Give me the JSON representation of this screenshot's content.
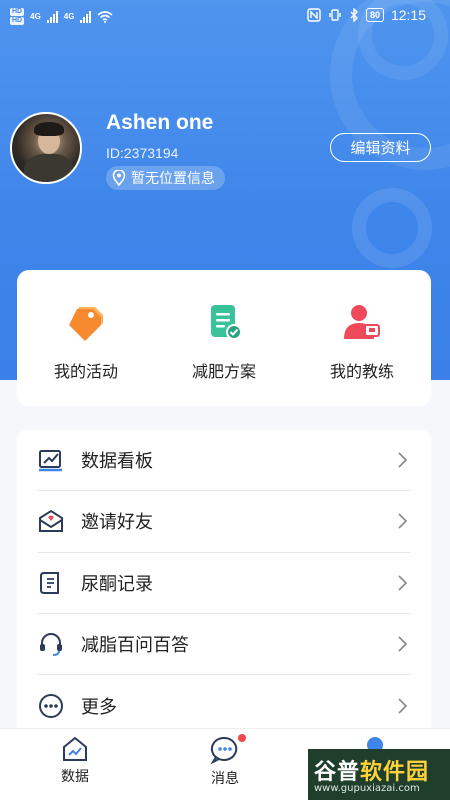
{
  "status_bar": {
    "hd_labels": [
      "HD",
      "HD"
    ],
    "network_labels": [
      "4G",
      "4G"
    ],
    "battery": "80",
    "time": "12:15"
  },
  "profile": {
    "name": "Ashen one",
    "id_text": "ID:2373194",
    "location": "暂无位置信息",
    "edit_button": "编辑资料"
  },
  "quick_actions": [
    {
      "label": "我的活动",
      "icon": "tag-icon",
      "color": "#f78a2e"
    },
    {
      "label": "减肥方案",
      "icon": "plan-document-icon",
      "color": "#3ac29a"
    },
    {
      "label": "我的教练",
      "icon": "coach-icon",
      "color": "#ee4a5b"
    }
  ],
  "menu": [
    {
      "label": "数据看板",
      "icon": "chart-board-icon"
    },
    {
      "label": "邀请好友",
      "icon": "invite-mail-icon"
    },
    {
      "label": "尿酮记录",
      "icon": "record-scroll-icon"
    },
    {
      "label": "减脂百问百答",
      "icon": "headset-icon"
    },
    {
      "label": "更多",
      "icon": "more-dots-icon"
    }
  ],
  "bottom_nav": [
    {
      "label": "数据",
      "icon": "home-chart-icon"
    },
    {
      "label": "消息",
      "icon": "message-icon",
      "has_dot": true
    },
    {
      "label": "",
      "icon": "profile-icon"
    }
  ],
  "watermark": {
    "main_part1": "谷普",
    "main_part2": "软件园",
    "sub": "www.gupuxiazai.com"
  },
  "colors": {
    "header_blue": "#3f86ea",
    "accent_red": "#f24a4a"
  }
}
